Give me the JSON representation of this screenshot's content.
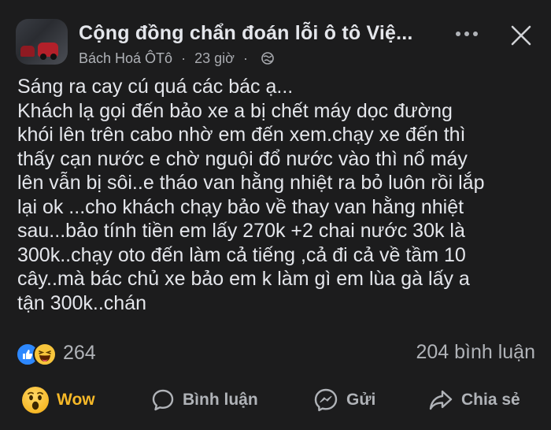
{
  "header": {
    "group_title": "Cộng đồng chẩn đoán lỗi ô tô Việ...",
    "author": "Bách Hoá ÔTô",
    "time": "23 giờ",
    "separator": "·",
    "more_icon": "more-dots-icon",
    "close_icon": "close-icon",
    "privacy_icon": "globe-icon"
  },
  "post": {
    "lines": [
      "Sáng ra cay cú quá các bác ạ...",
      "Khách lạ gọi đến bảo xe a bị chết máy dọc đường",
      "khói lên trên cabo nhờ em đến xem.chạy xe đến thì",
      "thấy cạn nước e chờ nguội đổ nước vào thì nổ máy",
      "lên vẫn bị sôi..e tháo van hằng nhiệt ra bỏ luôn rồi lắp",
      "lại ok ...cho khách chạy bảo về thay van hằng nhiệt",
      "sau...bảo tính tiền em lấy 270k +2 chai nước 30k là",
      "300k..chạy oto đến làm cả tiếng ,cả đi cả về tầm 10",
      "cây..mà bác chủ xe bảo em k làm gì em lùa gà lấy a",
      "tận 300k..chán"
    ]
  },
  "stats": {
    "reaction_count": "264",
    "comment_count": "204 bình luận",
    "reaction_icons": [
      "like-icon",
      "haha-icon"
    ]
  },
  "actions": {
    "wow_label": "Wow",
    "comment_label": "Bình luận",
    "send_label": "Gửi",
    "share_label": "Chia sẻ"
  },
  "colors": {
    "background": "#1c1c1d",
    "text": "#e4e6eb",
    "secondary_text": "#b0b3b8",
    "wow_accent": "#f7b928",
    "like_blue": "#2d88ff"
  }
}
